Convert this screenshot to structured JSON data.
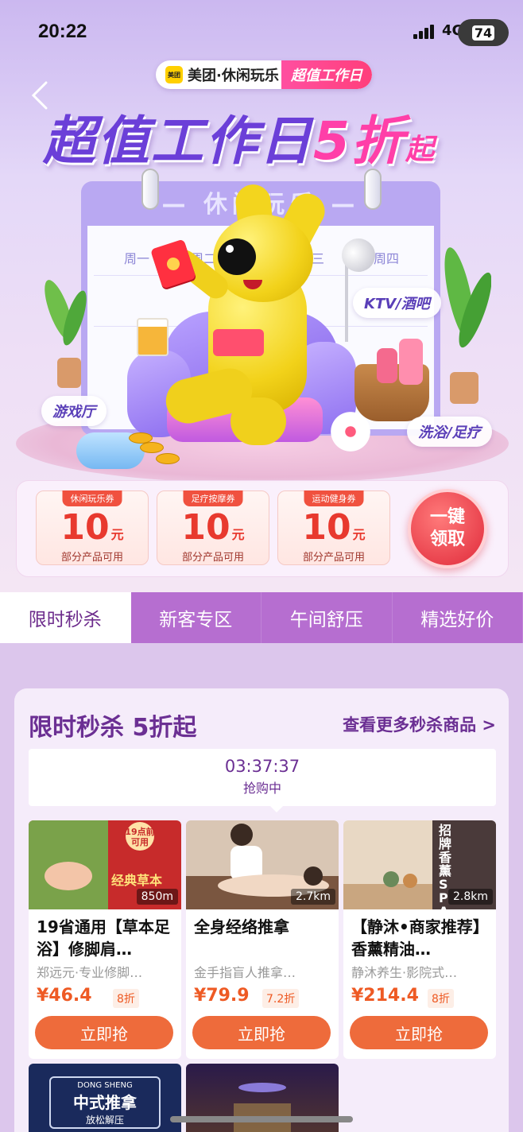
{
  "status_bar": {
    "time": "20:22",
    "network": "4G",
    "battery": "74"
  },
  "banner": {
    "brand_logo": "美团",
    "brand_name": "美团·休闲玩乐",
    "brand_tag": "超值工作日",
    "title_main": "超值工作日",
    "title_accent": "5折",
    "title_suffix": "起",
    "calendar_header": "— 休闲玩乐 —",
    "weekdays": [
      "周一",
      "周二",
      "周三",
      "周四"
    ],
    "scene_tags": {
      "ktv": "KTV/酒吧",
      "game": "游戏厅",
      "bath": "洗浴/足疗"
    }
  },
  "coupons": [
    {
      "name": "休闲玩乐券",
      "amount": "10",
      "unit": "元",
      "note": "部分产品可用"
    },
    {
      "name": "足疗按摩券",
      "amount": "10",
      "unit": "元",
      "note": "部分产品可用"
    },
    {
      "name": "运动健身券",
      "amount": "10",
      "unit": "元",
      "note": "部分产品可用"
    }
  ],
  "claim_button": {
    "line1": "一键",
    "line2": "领取"
  },
  "tabs": [
    {
      "label": "限时秒杀",
      "active": true
    },
    {
      "label": "新客专区",
      "active": false
    },
    {
      "label": "午间舒压",
      "active": false
    },
    {
      "label": "精选好价",
      "active": false
    }
  ],
  "flash_sale": {
    "title": "限时秒杀 5折起",
    "more_link": "查看更多秒杀商品 >",
    "countdown": "03:37:37",
    "countdown_status": "抢购中",
    "products": [
      {
        "name": "19省通用【草本足浴】修脚肩…",
        "shop": "郑远元·专业修脚…",
        "price": "¥46.4",
        "discount": "8折",
        "distance": "850m",
        "buy_label": "立即抢",
        "image_text": "经典草本",
        "image_badge": "19点前可用"
      },
      {
        "name": "全身经络推拿",
        "shop": "金手指盲人推拿…",
        "price": "¥79.9",
        "discount": "7.2折",
        "distance": "2.7km",
        "buy_label": "立即抢"
      },
      {
        "name": "【静沐•商家推荐】香薰精油…",
        "shop": "静沐养生·影院式…",
        "price": "¥214.4",
        "discount": "8折",
        "distance": "2.8km",
        "buy_label": "立即抢",
        "image_text": "招牌香薰SPA"
      }
    ],
    "next_products": [
      {
        "image_text": "中式推拿",
        "image_sub": "放松解压",
        "image_brand": "DONG SHENG"
      },
      {
        "image_text": ""
      }
    ]
  },
  "colors": {
    "tab_bar": "#b66ed0",
    "accent_orange": "#ee6b3b",
    "title_purple": "#6b2f93",
    "coupon_red": "#e8392e"
  }
}
